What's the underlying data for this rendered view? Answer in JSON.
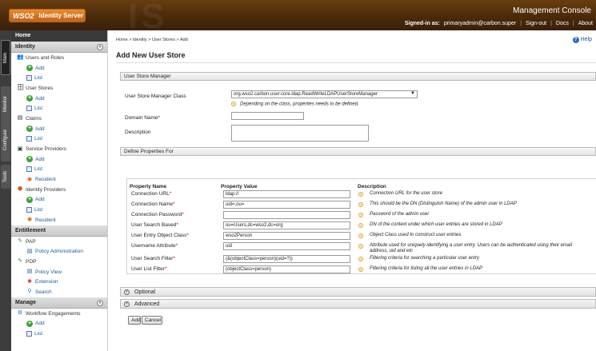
{
  "header": {
    "logo_brand": "WSO2",
    "logo_product": "Identity Server",
    "console": "Management Console",
    "signed_in_label": "Signed-in as:",
    "user": "primaryadmin@carbon.super",
    "signout": "Sign-out",
    "docs": "Docs",
    "about": "About",
    "sep": "|"
  },
  "vtabs": {
    "main": "Main",
    "monitor": "Monitor",
    "configure": "Configure",
    "tools": "Tools"
  },
  "menu": {
    "home": "Home",
    "identity": "Identity",
    "users_roles": "Users and Roles",
    "add": "Add",
    "list": "List",
    "user_stores": "User Stores",
    "claims": "Claims",
    "service_providers": "Service Providers",
    "resident": "Resident",
    "identity_providers": "Identity Providers",
    "entitlement": "Entitlement",
    "pap": "PAP",
    "policy_admin": "Policy Administration",
    "pdp": "PDP",
    "policy_view": "Policy View",
    "extension": "Extension",
    "search": "Search",
    "manage": "Manage",
    "workflow": "Workflow Engagements"
  },
  "breadcrumb": "Home > Identity > User Stores > Add",
  "help": "Help",
  "page_title": "Add New User Store",
  "usm": {
    "section": "User Store Manager",
    "class_label": "User Store Manager Class",
    "class_value": "org.wso2.carbon.user.core.ldap.ReadWriteLDAPUserStoreManager",
    "class_note": "Depending on the class, properties needs to be defined.",
    "domain_label": "Domain Name",
    "description_label": "Description",
    "domain_value": "",
    "description_value": ""
  },
  "props": {
    "section": "Define Properties For",
    "col_name": "Property Name",
    "col_value": "Property Value",
    "col_desc": "Description",
    "rows": [
      {
        "name": "Connection URL",
        "value": "ldap://",
        "desc": "Connection URL for the user store"
      },
      {
        "name": "Connection Name",
        "value": "uid=,ou=",
        "desc": "This should be the DN (Distinguish Name) of the admin user in LDAP"
      },
      {
        "name": "Connection Password",
        "value": "",
        "desc": "Password of the admin user"
      },
      {
        "name": "User Search Based",
        "value": "ou=Users,dc=wso2,dc=org",
        "desc": "DN of the context under which user entries are stored in LDAP"
      },
      {
        "name": "User Entry Object Class",
        "value": "wso2Person",
        "desc": "Object Class used to construct user entries"
      },
      {
        "name": "Username Attribute",
        "value": "uid",
        "desc": "Attribute used for uniquely identifying a user entry. Users can be authenticated using their email address, uid and etc"
      },
      {
        "name": "User Search Filter",
        "value": "(&(objectClass=person)(uid=?))",
        "desc": "Filtering criteria for searching a particular user entry"
      },
      {
        "name": "User List Filter",
        "value": "(objectClass=person)",
        "desc": "Filtering criteria for listing all the user entries in LDAP"
      }
    ]
  },
  "optional": "Optional",
  "advanced": "Advanced",
  "add_button": "Add",
  "cancel_button": "Cancel"
}
